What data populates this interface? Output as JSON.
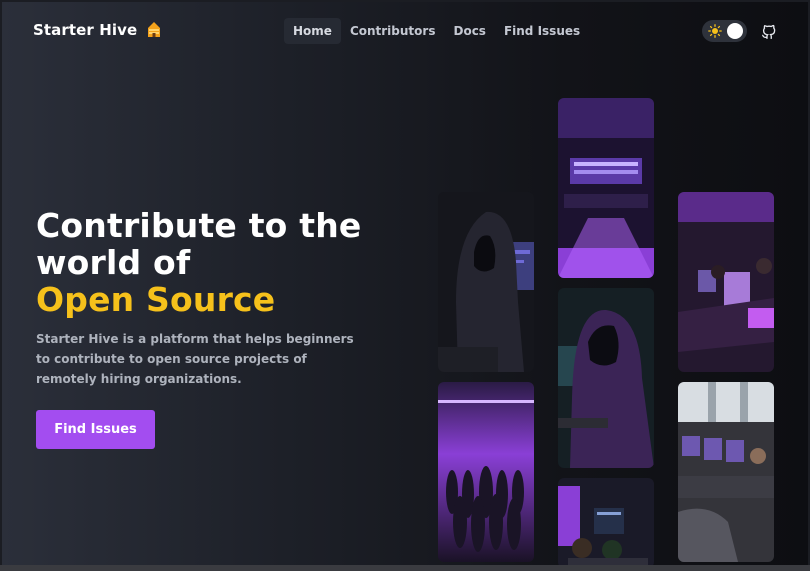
{
  "nav": {
    "brand": "Starter Hive",
    "brand_icon": "hive-icon",
    "links": [
      "Home",
      "Contributors",
      "Docs",
      "Find Issues"
    ],
    "active_link": "Home",
    "theme_toggle_icon": "sun-icon",
    "github_icon": "github-icon"
  },
  "hero": {
    "title_line1": "Contribute to the",
    "title_line2": "world of",
    "title_accent": "Open Source",
    "description": "Starter Hive is a platform that helps beginners to contribute to open source projects of remotely hiring organizations.",
    "cta_label": "Find Issues"
  },
  "colors": {
    "accent_yellow": "#f6c11b",
    "button_purple": "#a34df0",
    "image_purple": "#8a3fd6"
  },
  "images": [
    "hooded-coder-image",
    "crowd-purple-image",
    "control-room-image",
    "hooded-laptop-image",
    "developers-image",
    "purple-lab-image",
    "computer-lab-image"
  ]
}
